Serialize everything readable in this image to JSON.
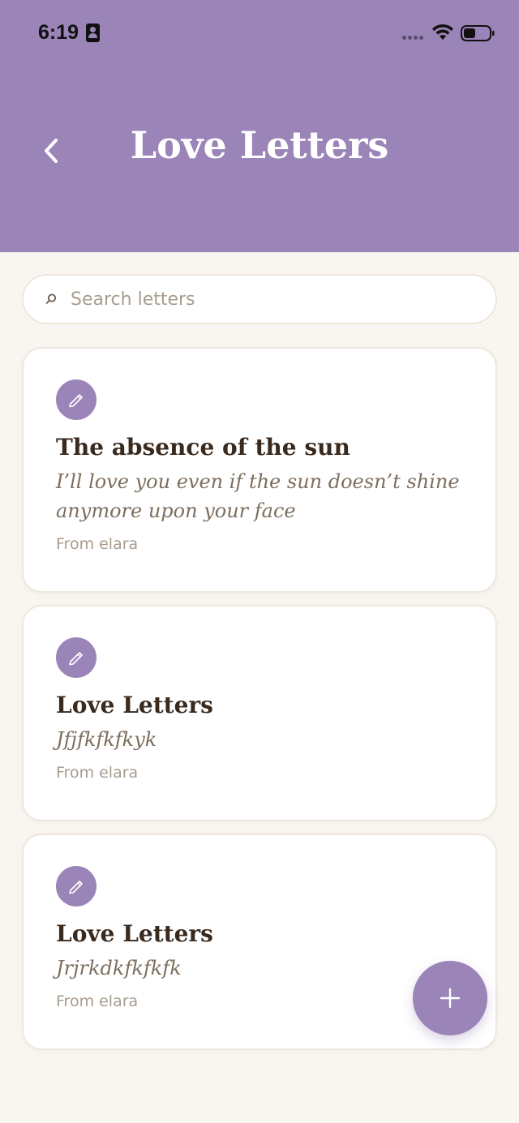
{
  "status_bar": {
    "time": "6:19"
  },
  "header": {
    "title": "Love Letters",
    "back_icon": "chevron-left-icon"
  },
  "search": {
    "placeholder": "Search letters",
    "value": ""
  },
  "letters": [
    {
      "title": "The absence of the sun",
      "excerpt": "I’ll love you even if the sun doesn’t shine anymore upon your face",
      "from": "From elara",
      "icon": "pencil-icon"
    },
    {
      "title": "Love Letters",
      "excerpt": "Jfjfkfkfkyk",
      "from": "From elara",
      "icon": "pencil-icon"
    },
    {
      "title": "Love Letters",
      "excerpt": "Jrjrkdkfkfkfk",
      "from": "From elara",
      "icon": "pencil-icon"
    }
  ],
  "fab": {
    "icon": "plus-icon"
  },
  "colors": {
    "accent": "#9b84b8",
    "background": "#f9f6f1",
    "card": "#ffffff",
    "title_text": "#3a2a1e",
    "excerpt_text": "#7d6e5e",
    "muted_text": "#a89c8e"
  }
}
